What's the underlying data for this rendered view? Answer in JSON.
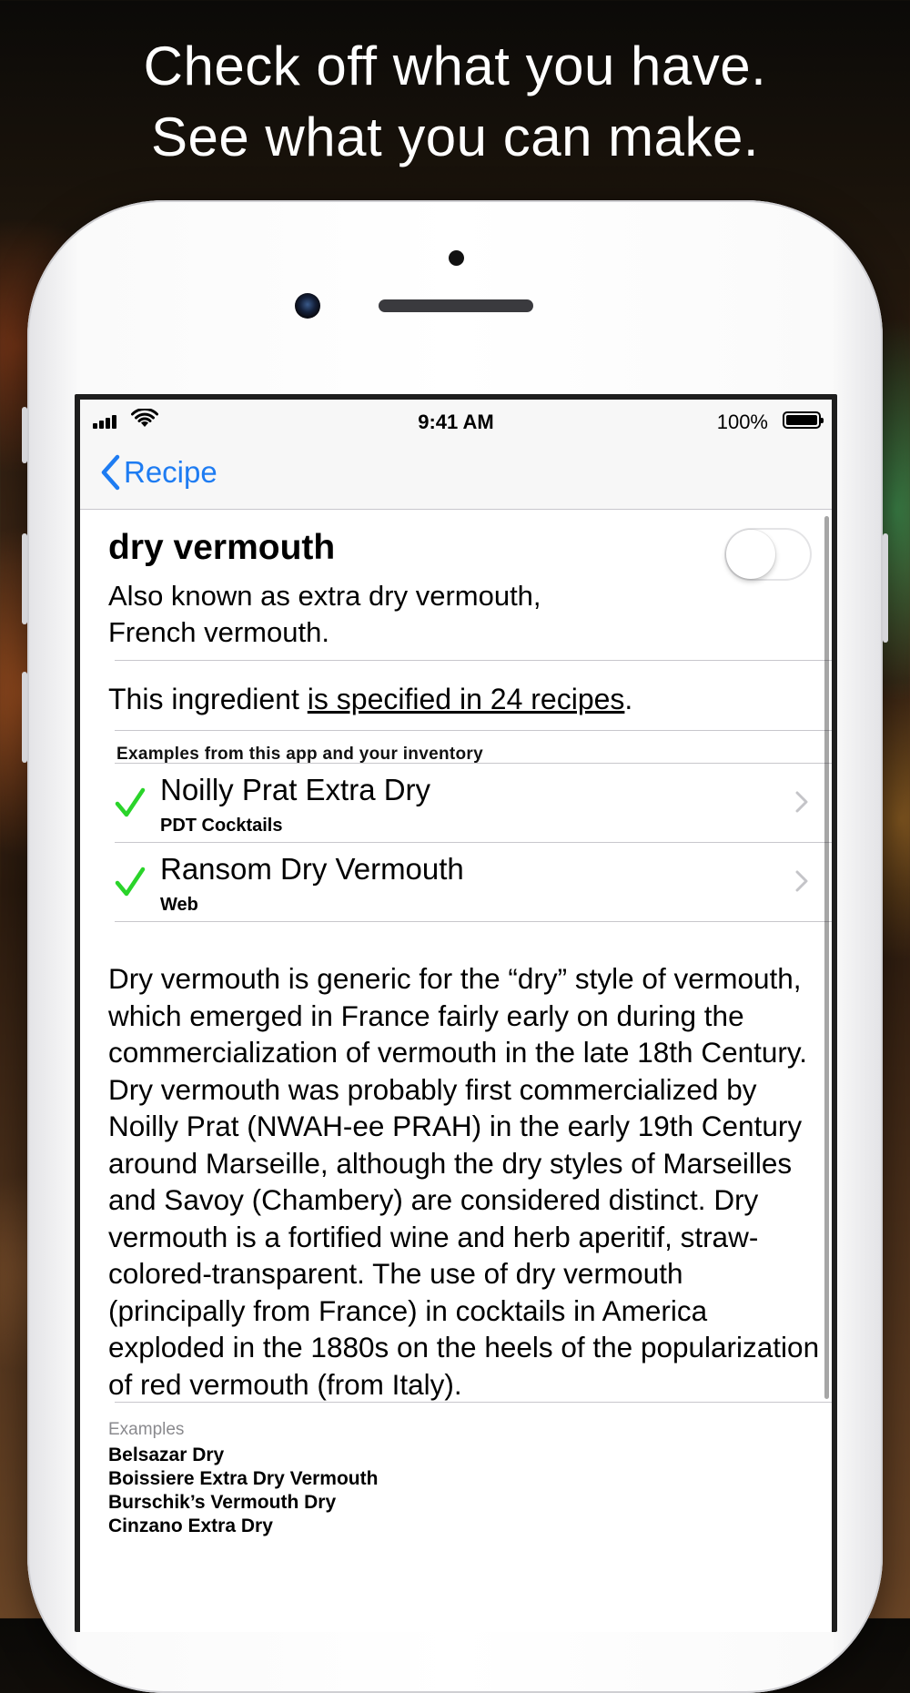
{
  "headline": {
    "line1": "Check off what you have.",
    "line2": "See what you can make."
  },
  "statusbar": {
    "time": "9:41 AM",
    "battery": "100%",
    "icons": [
      "signal-icon",
      "wifi-icon",
      "battery-icon"
    ]
  },
  "nav": {
    "back_label": "Recipe"
  },
  "ingredient": {
    "name": "dry vermouth",
    "aka_line1": "Also known as extra dry vermouth,",
    "aka_line2": "French vermouth.",
    "in_inventory": false,
    "spec_prefix": "This ingredient ",
    "spec_link": "is specified in 24 recipes",
    "spec_suffix": "."
  },
  "examples_header": "Examples from this app and your inventory",
  "example_rows": [
    {
      "name": "Noilly Prat Extra Dry",
      "source": "PDT Cocktails",
      "checked": true
    },
    {
      "name": "Ransom Dry Vermouth",
      "source": "Web",
      "checked": true
    }
  ],
  "description": "Dry vermouth is generic for the “dry” style of vermouth, which emerged in France fairly early on during the commercialization of vermouth in the late 18th Century. Dry vermouth was probably first commercialized by Noilly Prat (NWAH-ee PRAH) in the early 19th Century around Marseille, although the dry styles of Marseilles and Savoy (Chambery) are considered distinct. Dry vermouth is a fortified wine and herb aperitif, straw-colored-transparent. The use of dry vermouth (principally from France) in cocktails in America exploded in the 1880s on the heels of the popularization of red vermouth (from Italy).",
  "examples": {
    "label": "Examples",
    "items": [
      "Belsazar Dry",
      "Boissiere Extra Dry Vermouth",
      "Burschik’s Vermouth Dry",
      "Cinzano Extra Dry"
    ]
  },
  "colors": {
    "accent": "#1e7cf2",
    "check": "#2ad42a",
    "separator": "#c8c7cc"
  }
}
